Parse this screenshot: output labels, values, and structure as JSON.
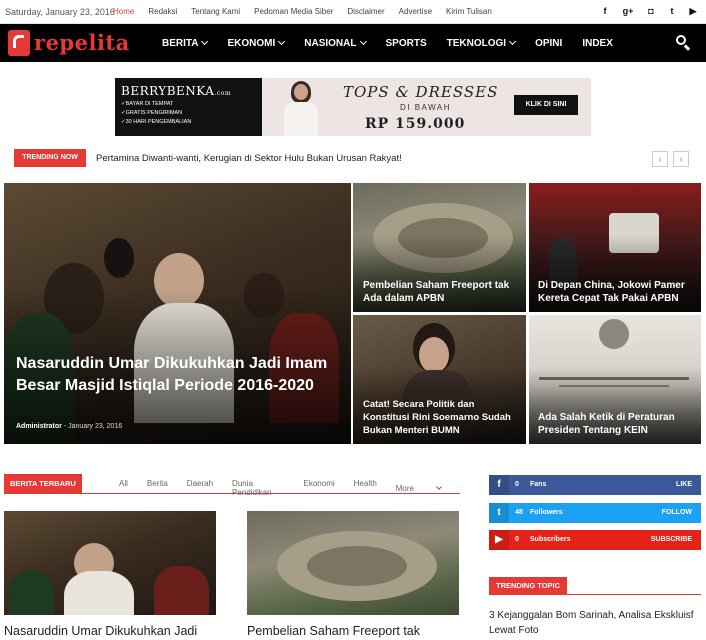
{
  "topbar": {
    "date": "Saturday, January 23, 2016",
    "links": [
      "Home",
      "Redaksi",
      "Tentang Kami",
      "Pedoman Media Siber",
      "Disclaimer",
      "Advertise",
      "Kirim Tulisan"
    ],
    "social": [
      {
        "icon": "facebook-icon",
        "glyph": "f"
      },
      {
        "icon": "google-plus-icon",
        "glyph": "g+"
      },
      {
        "icon": "instagram-icon",
        "glyph": "◘"
      },
      {
        "icon": "twitter-icon",
        "glyph": "t"
      },
      {
        "icon": "youtube-icon",
        "glyph": "▶"
      }
    ]
  },
  "nav": {
    "logo_text": "repelita",
    "items": [
      {
        "label": "BERITA",
        "dropdown": true
      },
      {
        "label": "EKONOMI",
        "dropdown": true
      },
      {
        "label": "NASIONAL",
        "dropdown": true
      },
      {
        "label": "SPORTS",
        "dropdown": false
      },
      {
        "label": "TEKNOLOGI",
        "dropdown": true
      },
      {
        "label": "OPINI",
        "dropdown": false
      },
      {
        "label": "INDEX",
        "dropdown": false
      }
    ]
  },
  "ad": {
    "brand": "BERRYBENKA",
    "brand_suffix": ".com",
    "perks": [
      "BAYAR DI TEMPAT",
      "GRATIS PENGIRIMAN",
      "30 HARI PENGEMBALIAN"
    ],
    "headline": "TOPS & DRESSES",
    "subline": "DI BAWAH",
    "price": "RP 159.000",
    "cta": "KLIK DI SINI"
  },
  "trending_now": {
    "label": "TRENDING NOW",
    "headline": "Pertamina Diwanti-wanti, Kerugian di Sektor Hulu Bukan Urusan Rakyat!",
    "prev": "‹",
    "next": "›"
  },
  "featured": {
    "main": {
      "title": "Nasaruddin Umar Dikukuhkan Jadi Imam Besar Masjid Istiqlal Periode 2016-2020",
      "author": "Administrator",
      "date": "January 23, 2016"
    },
    "small": [
      {
        "title": "Pembelian Saham Freeport tak Ada dalam APBN"
      },
      {
        "title": "Di Depan China, Jokowi Pamer Kereta Cepat Tak Pakai APBN"
      },
      {
        "title": "Catat! Secara Politik dan Konstitusi Rini Soemarno Sudah Bukan Menteri BUMN"
      },
      {
        "title": "Ada Salah Ketik di Peraturan Presiden Tentang KEIN"
      }
    ]
  },
  "berita_terbaru": {
    "label": "BERITA TERBARU",
    "tabs": [
      "All",
      "Berita",
      "Daerah",
      "Dunia Pendidikan",
      "Ekonomi",
      "Health"
    ],
    "more": "More",
    "cards": [
      {
        "title": "Nasaruddin Umar Dikukuhkan Jadi"
      },
      {
        "title": "Pembelian Saham Freeport tak"
      }
    ]
  },
  "social_counters": [
    {
      "icon": "facebook-icon",
      "glyph": "f",
      "count": "0",
      "label": "Fans",
      "action": "LIKE",
      "color": "#3b5998"
    },
    {
      "icon": "twitter-icon",
      "glyph": "t",
      "count": "48",
      "label": "Followers",
      "action": "FOLLOW",
      "color": "#1da1f2"
    },
    {
      "icon": "youtube-icon",
      "glyph": "▶",
      "count": "0",
      "label": "Subscribers",
      "action": "SUBSCRIBE",
      "color": "#e62117"
    }
  ],
  "trending_topic": {
    "label": "TRENDING TOPIC",
    "items": [
      "3 Kejanggalan Bom Sarinah, Analisa Ekskluisf Lewat Foto"
    ]
  },
  "colors": {
    "accent": "#e53935",
    "nav_bg": "#000000"
  }
}
